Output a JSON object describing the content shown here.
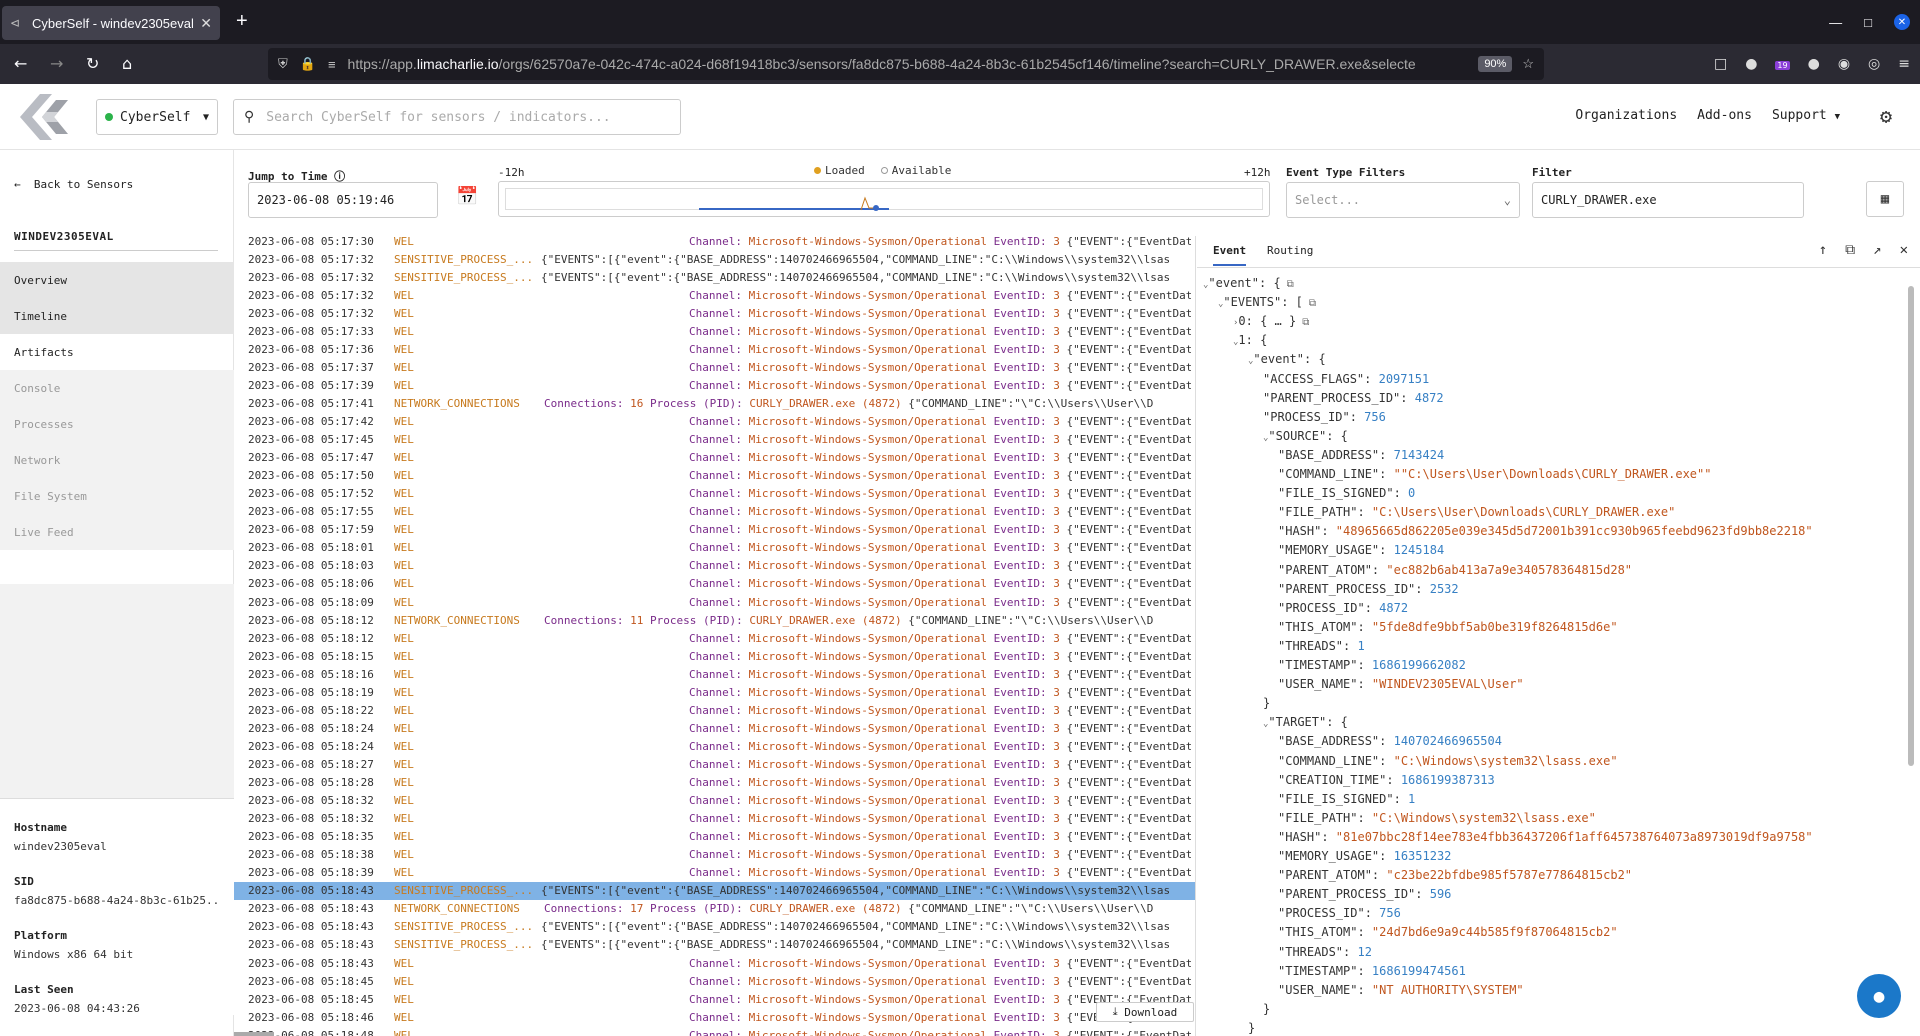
{
  "browser": {
    "tab_title": "CyberSelf - windev2305eval",
    "url_host_prefix": "https://app.",
    "url_host": "limacharlie.io",
    "url_path": "/orgs/62570a7e-042c-474c-a024-d68f19418bc3/sensors/fa8dc875-b688-4a24-8b3c-61b2545cf146/timeline?search=CURLY_DRAWER.exe&selecte",
    "zoom": "90%",
    "ext_badge": "19"
  },
  "header": {
    "org_name": "CyberSelf",
    "search_placeholder": "Search CyberSelf for sensors / indicators...",
    "nav": [
      "Organizations",
      "Add-ons",
      "Support"
    ]
  },
  "sidebar": {
    "back_label": "Back to Sensors",
    "sensor_name": "WINDEV2305EVAL",
    "menu": [
      "Overview",
      "Timeline",
      "Artifacts",
      "Console",
      "Processes",
      "Network",
      "File System",
      "Live Feed"
    ],
    "info": [
      {
        "label": "Hostname",
        "value": "windev2305eval"
      },
      {
        "label": "SID",
        "value": "fa8dc875-b688-4a24-8b3c-61b25..."
      },
      {
        "label": "Platform",
        "value": "Windows x86 64 bit"
      },
      {
        "label": "Last Seen",
        "value": "2023-06-08 04:43:26"
      }
    ]
  },
  "controls": {
    "jump_label": "Jump to Time",
    "jump_value": "2023-06-08 05:19:46",
    "range_left": "-12h",
    "range_right": "+12h",
    "legend_loaded": "Loaded",
    "legend_available": "Available",
    "event_filter_label": "Event Type Filters",
    "event_filter_placeholder": "Select...",
    "filter_label": "Filter",
    "filter_value": "CURLY_DRAWER.exe"
  },
  "events": {
    "download_label": "Download",
    "label_channel": "Channel:",
    "channel": "Microsoft-Windows-Sysmon/Operational",
    "label_eventid": "EventID:",
    "eventid": "3",
    "wel_json": "{\"EVENT\":{\"EventData\":{\"Destination",
    "sens_json": "{\"EVENTS\":[{\"event\":{\"BASE_ADDRESS\":140702466965504,\"COMMAND_LINE\":\"C:\\\\Windows\\\\system32\\\\lsas",
    "net_label_conn": "Connections:",
    "net_label_proc": "Process (PID):",
    "net_proc": "CURLY_DRAWER.exe (4872)",
    "net_json": "{\"COMMAND_LINE\":\"\\\"C:\\\\Users\\\\User\\\\D",
    "rows": [
      {
        "time": "2023-06-08 05:17:30",
        "type": "WEL"
      },
      {
        "time": "2023-06-08 05:17:32",
        "type": "SENSITIVE_PROCESS_..."
      },
      {
        "time": "2023-06-08 05:17:32",
        "type": "SENSITIVE_PROCESS_..."
      },
      {
        "time": "2023-06-08 05:17:32",
        "type": "WEL"
      },
      {
        "time": "2023-06-08 05:17:32",
        "type": "WEL"
      },
      {
        "time": "2023-06-08 05:17:33",
        "type": "WEL"
      },
      {
        "time": "2023-06-08 05:17:36",
        "type": "WEL"
      },
      {
        "time": "2023-06-08 05:17:37",
        "type": "WEL"
      },
      {
        "time": "2023-06-08 05:17:39",
        "type": "WEL"
      },
      {
        "time": "2023-06-08 05:17:41",
        "type": "NETWORK_CONNECTIONS",
        "conns": "16"
      },
      {
        "time": "2023-06-08 05:17:42",
        "type": "WEL"
      },
      {
        "time": "2023-06-08 05:17:45",
        "type": "WEL"
      },
      {
        "time": "2023-06-08 05:17:47",
        "type": "WEL"
      },
      {
        "time": "2023-06-08 05:17:50",
        "type": "WEL"
      },
      {
        "time": "2023-06-08 05:17:52",
        "type": "WEL"
      },
      {
        "time": "2023-06-08 05:17:55",
        "type": "WEL"
      },
      {
        "time": "2023-06-08 05:17:59",
        "type": "WEL"
      },
      {
        "time": "2023-06-08 05:18:01",
        "type": "WEL"
      },
      {
        "time": "2023-06-08 05:18:03",
        "type": "WEL"
      },
      {
        "time": "2023-06-08 05:18:06",
        "type": "WEL"
      },
      {
        "time": "2023-06-08 05:18:09",
        "type": "WEL"
      },
      {
        "time": "2023-06-08 05:18:12",
        "type": "NETWORK_CONNECTIONS",
        "conns": "11"
      },
      {
        "time": "2023-06-08 05:18:12",
        "type": "WEL"
      },
      {
        "time": "2023-06-08 05:18:15",
        "type": "WEL"
      },
      {
        "time": "2023-06-08 05:18:16",
        "type": "WEL"
      },
      {
        "time": "2023-06-08 05:18:19",
        "type": "WEL"
      },
      {
        "time": "2023-06-08 05:18:22",
        "type": "WEL"
      },
      {
        "time": "2023-06-08 05:18:24",
        "type": "WEL"
      },
      {
        "time": "2023-06-08 05:18:24",
        "type": "WEL"
      },
      {
        "time": "2023-06-08 05:18:27",
        "type": "WEL"
      },
      {
        "time": "2023-06-08 05:18:28",
        "type": "WEL"
      },
      {
        "time": "2023-06-08 05:18:32",
        "type": "WEL"
      },
      {
        "time": "2023-06-08 05:18:32",
        "type": "WEL"
      },
      {
        "time": "2023-06-08 05:18:35",
        "type": "WEL"
      },
      {
        "time": "2023-06-08 05:18:38",
        "type": "WEL"
      },
      {
        "time": "2023-06-08 05:18:39",
        "type": "WEL"
      },
      {
        "time": "2023-06-08 05:18:43",
        "type": "SENSITIVE_PROCESS_...",
        "selected": true
      },
      {
        "time": "2023-06-08 05:18:43",
        "type": "NETWORK_CONNECTIONS",
        "conns": "17"
      },
      {
        "time": "2023-06-08 05:18:43",
        "type": "SENSITIVE_PROCESS_..."
      },
      {
        "time": "2023-06-08 05:18:43",
        "type": "SENSITIVE_PROCESS_..."
      },
      {
        "time": "2023-06-08 05:18:43",
        "type": "WEL"
      },
      {
        "time": "2023-06-08 05:18:45",
        "type": "WEL"
      },
      {
        "time": "2023-06-08 05:18:45",
        "type": "WEL"
      },
      {
        "time": "2023-06-08 05:18:46",
        "type": "WEL"
      },
      {
        "time": "2023-06-08 05:18:48",
        "type": "WEL"
      }
    ]
  },
  "detail": {
    "tabs": [
      "Event",
      "Routing"
    ],
    "tree": [
      {
        "d": 0,
        "tg": "⌄",
        "t": "\"event\": {",
        "cp": true
      },
      {
        "d": 1,
        "tg": "⌄",
        "t": "\"EVENTS\": [",
        "cp": true
      },
      {
        "d": 2,
        "tg": "›",
        "t": "0: { … }",
        "cp": true
      },
      {
        "d": 2,
        "tg": "⌄",
        "t": "1: {"
      },
      {
        "d": 3,
        "tg": "⌄",
        "t": "\"event\": {"
      },
      {
        "d": 4,
        "k": "\"ACCESS_FLAGS\": ",
        "n": "2097151"
      },
      {
        "d": 4,
        "k": "\"PARENT_PROCESS_ID\": ",
        "n": "4872"
      },
      {
        "d": 4,
        "k": "\"PROCESS_ID\": ",
        "n": "756"
      },
      {
        "d": 4,
        "tg": "⌄",
        "t": "\"SOURCE\": {"
      },
      {
        "d": 5,
        "k": "\"BASE_ADDRESS\": ",
        "n": "7143424"
      },
      {
        "d": 5,
        "k": "\"COMMAND_LINE\": ",
        "s": "\"\"C:\\Users\\User\\Downloads\\CURLY_DRAWER.exe\"\""
      },
      {
        "d": 5,
        "k": "\"FILE_IS_SIGNED\": ",
        "n": "0"
      },
      {
        "d": 5,
        "k": "\"FILE_PATH\": ",
        "s": "\"C:\\Users\\User\\Downloads\\CURLY_DRAWER.exe\""
      },
      {
        "d": 5,
        "k": "\"HASH\": ",
        "s": "\"48965665d862205e039e345d5d72001b391cc930b965feebd9623fd9bb8e2218\""
      },
      {
        "d": 5,
        "k": "\"MEMORY_USAGE\": ",
        "n": "1245184"
      },
      {
        "d": 5,
        "k": "\"PARENT_ATOM\": ",
        "s": "\"ec882b6ab413a7a9e340578364815d28\""
      },
      {
        "d": 5,
        "k": "\"PARENT_PROCESS_ID\": ",
        "n": "2532"
      },
      {
        "d": 5,
        "k": "\"PROCESS_ID\": ",
        "n": "4872"
      },
      {
        "d": 5,
        "k": "\"THIS_ATOM\": ",
        "s": "\"5fde8dfe9bbf5ab0be319f8264815d6e\""
      },
      {
        "d": 5,
        "k": "\"THREADS\": ",
        "n": "1"
      },
      {
        "d": 5,
        "k": "\"TIMESTAMP\": ",
        "n": "1686199662082"
      },
      {
        "d": 5,
        "k": "\"USER_NAME\": ",
        "s": "\"WINDEV2305EVAL\\User\""
      },
      {
        "d": 4,
        "t": "}"
      },
      {
        "d": 4,
        "tg": "⌄",
        "t": "\"TARGET\": {"
      },
      {
        "d": 5,
        "k": "\"BASE_ADDRESS\": ",
        "n": "140702466965504"
      },
      {
        "d": 5,
        "k": "\"COMMAND_LINE\": ",
        "s": "\"C:\\Windows\\system32\\lsass.exe\""
      },
      {
        "d": 5,
        "k": "\"CREATION_TIME\": ",
        "n": "1686199387313"
      },
      {
        "d": 5,
        "k": "\"FILE_IS_SIGNED\": ",
        "n": "1"
      },
      {
        "d": 5,
        "k": "\"FILE_PATH\": ",
        "s": "\"C:\\Windows\\system32\\lsass.exe\""
      },
      {
        "d": 5,
        "k": "\"HASH\": ",
        "s": "\"81e07bbc28f14ee783e4fbb36437206f1aff645738764073a8973019df9a9758\""
      },
      {
        "d": 5,
        "k": "\"MEMORY_USAGE\": ",
        "n": "16351232"
      },
      {
        "d": 5,
        "k": "\"PARENT_ATOM\": ",
        "s": "\"c23be22bfdbe985f5787e77864815cb2\""
      },
      {
        "d": 5,
        "k": "\"PARENT_PROCESS_ID\": ",
        "n": "596"
      },
      {
        "d": 5,
        "k": "\"PROCESS_ID\": ",
        "n": "756"
      },
      {
        "d": 5,
        "k": "\"THIS_ATOM\": ",
        "s": "\"24d7bd6e9a9c44b585f9f87064815cb2\""
      },
      {
        "d": 5,
        "k": "\"THREADS\": ",
        "n": "12"
      },
      {
        "d": 5,
        "k": "\"TIMESTAMP\": ",
        "n": "1686199474561"
      },
      {
        "d": 5,
        "k": "\"USER_NAME\": ",
        "s": "\"NT AUTHORITY\\SYSTEM\""
      },
      {
        "d": 4,
        "t": "}"
      },
      {
        "d": 3,
        "t": "}"
      }
    ]
  }
}
